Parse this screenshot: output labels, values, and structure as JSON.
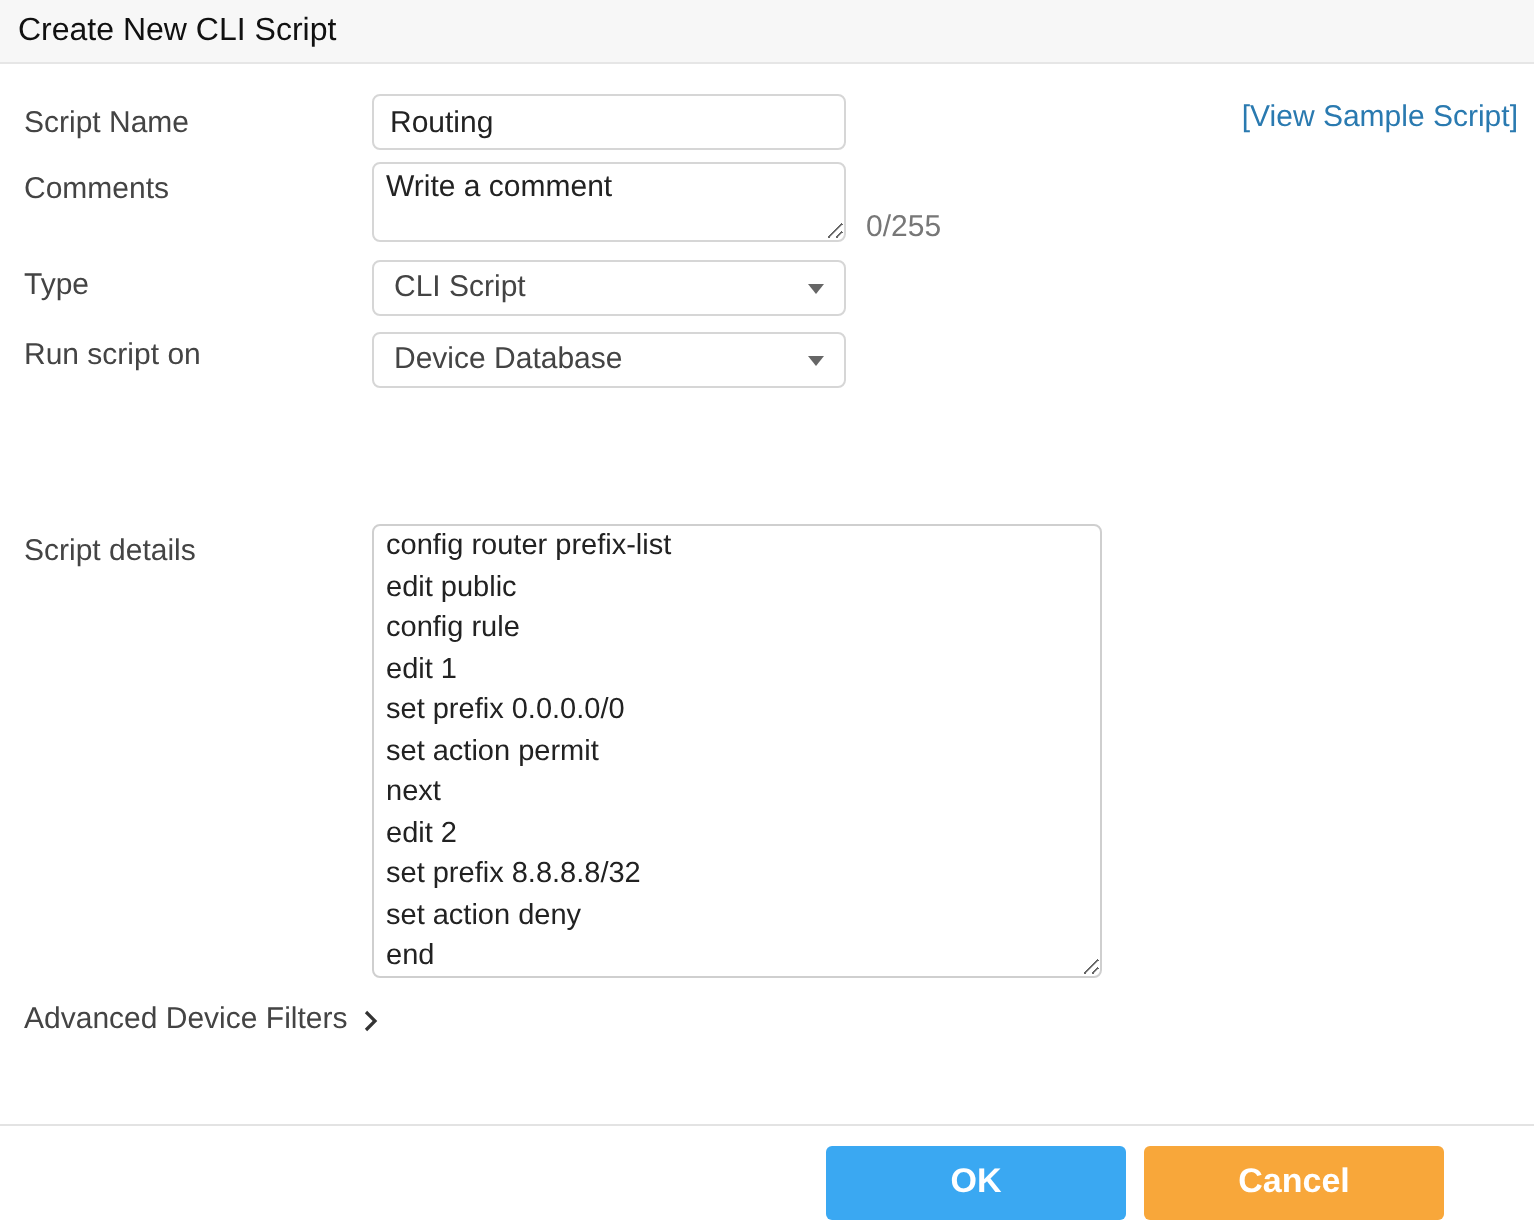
{
  "window": {
    "title": "Create New CLI Script"
  },
  "form": {
    "script_name": {
      "label": "Script Name",
      "value": "Routing"
    },
    "sample_link": "[View Sample Script]",
    "comments": {
      "label": "Comments",
      "placeholder": "Write a comment",
      "counter": "0/255"
    },
    "type": {
      "label": "Type",
      "value": "CLI Script"
    },
    "run_on": {
      "label": "Run script on",
      "value": "Device Database"
    },
    "script_details": {
      "label": "Script details",
      "lines": [
        "config router prefix-list",
        "edit public",
        "config rule",
        "edit 1",
        "set prefix 0.0.0.0/0",
        "set action permit",
        "next",
        "edit 2",
        "set prefix 8.8.8.8/32",
        "set action deny",
        "end"
      ]
    },
    "advanced": {
      "label": "Advanced Device Filters",
      "expanded": false
    }
  },
  "buttons": [
    {
      "label": "OK",
      "kind": "primary"
    },
    {
      "label": "Cancel",
      "kind": "secondary"
    }
  ]
}
